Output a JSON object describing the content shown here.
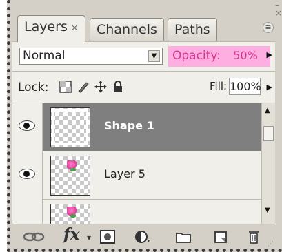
{
  "tabs": [
    {
      "label": "Layers",
      "close": "×",
      "active": true
    },
    {
      "label": "Channels",
      "active": false
    },
    {
      "label": "Paths",
      "active": false
    }
  ],
  "panel_menu_icon": "panel-menu-icon",
  "blend_mode": {
    "value": "Normal"
  },
  "opacity": {
    "label": "Opacity:",
    "value": "50%",
    "highlight_color": "#ffaee2",
    "text_color": "#d6378c"
  },
  "lock": {
    "label": "Lock:",
    "icons": [
      "lock-transparency-icon",
      "lock-pixels-icon",
      "lock-position-icon",
      "lock-all-icon"
    ]
  },
  "fill": {
    "label": "Fill:",
    "value": "100%"
  },
  "layers": [
    {
      "name": "Shape 1",
      "visible": true,
      "selected": true,
      "thumbnail": "transparent"
    },
    {
      "name": "Layer 5",
      "visible": true,
      "selected": false,
      "thumbnail": "flower"
    },
    {
      "name": "",
      "visible": false,
      "selected": false,
      "thumbnail": "flower"
    }
  ],
  "toolbar": {
    "fx_label": "fx",
    "icons": [
      "link-layers-icon",
      "fx-icon",
      "layer-mask-icon",
      "adjustment-layer-icon",
      "new-group-icon",
      "new-layer-icon",
      "trash-icon"
    ]
  },
  "colors": {
    "panel_bg": "#f0efea",
    "selected_row": "#7f7f7f",
    "chrome": "#d4d0c8"
  }
}
